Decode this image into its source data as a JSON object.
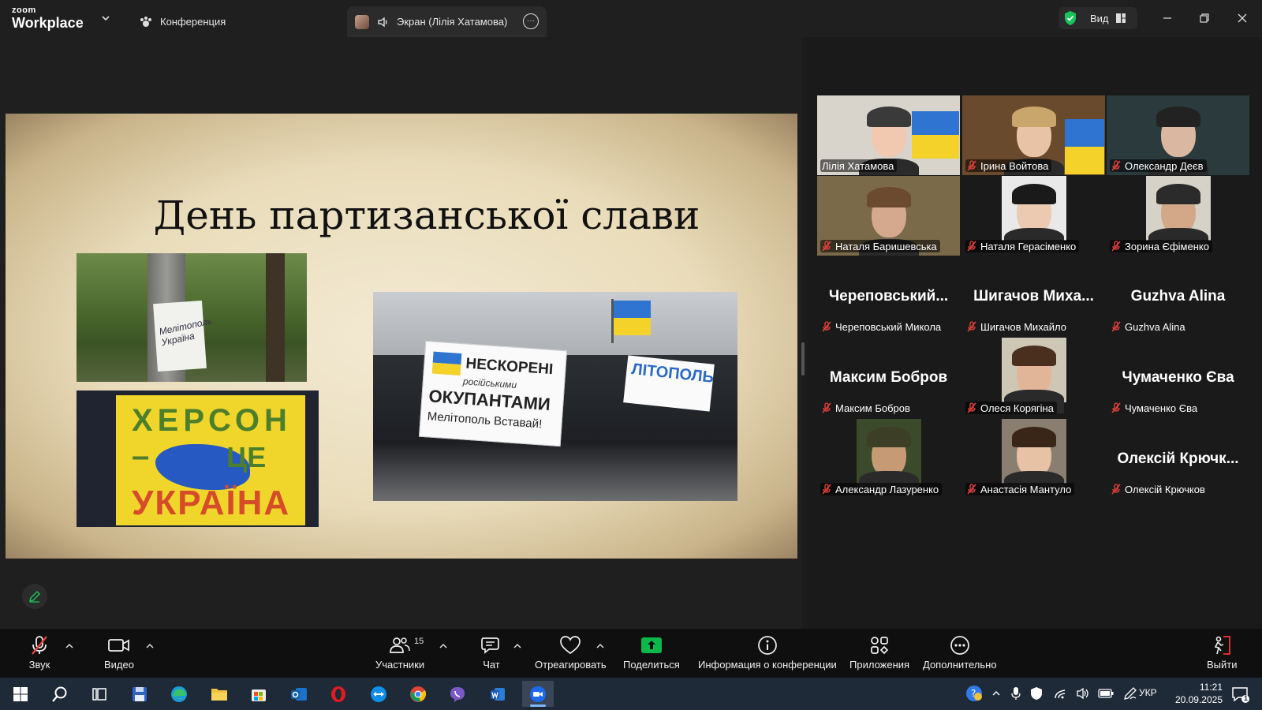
{
  "titlebar": {
    "logo_top": "zoom",
    "logo_bottom": "Workplace",
    "meeting_tab": "Конференция",
    "screen_tab": "Экран (Лілія Хатамова)",
    "view_label": "Вид"
  },
  "slide": {
    "title": "День партизанської слави",
    "photo1_note": "Мелітополь Україна",
    "photo2_line1": "ХЕРСОН –",
    "photo2_line2": "ЦЕ",
    "photo2_line3": "УКРАЇНА",
    "photo3_banner_line1": "НЕСКОРЕНІ",
    "photo3_banner_line2": "російськими",
    "photo3_banner_line3": "ОКУПАНТАМИ",
    "photo3_banner_line4": "Мелітополь Вставай!",
    "photo3_banner2": "ЛІТОПОЛЬ"
  },
  "gallery": {
    "tiles": [
      {
        "name": "Лілія Хатамова",
        "big": "",
        "video": true,
        "active": true,
        "muted": false
      },
      {
        "name": "Ірина Войтова",
        "big": "",
        "video": true,
        "active": false,
        "muted": true
      },
      {
        "name": "Олександр Деєв",
        "big": "",
        "video": true,
        "active": false,
        "muted": true
      },
      {
        "name": "Наталя Баришевська",
        "big": "",
        "video": true,
        "active": false,
        "muted": true
      },
      {
        "name": "Наталя Герасіменко",
        "big": "",
        "video": true,
        "active": false,
        "muted": true
      },
      {
        "name": "Зорина  Єфіменко",
        "big": "",
        "video": true,
        "active": false,
        "muted": true
      },
      {
        "name": "Череповський Микола",
        "big": "Череповський...",
        "video": false,
        "active": false,
        "muted": true
      },
      {
        "name": "Шигачов Михайло",
        "big": "Шигачов  Миха...",
        "video": false,
        "active": false,
        "muted": true
      },
      {
        "name": "Guzhva Alina",
        "big": "Guzhva Alina",
        "video": false,
        "active": false,
        "muted": true
      },
      {
        "name": "Максим Бобров",
        "big": "Максим Бобров",
        "video": false,
        "active": false,
        "muted": true
      },
      {
        "name": "Олеся Корягіна",
        "big": "",
        "video": true,
        "active": false,
        "muted": true
      },
      {
        "name": "Чумаченко Єва",
        "big": "Чумаченко Єва",
        "video": false,
        "active": false,
        "muted": true
      },
      {
        "name": "Александр Лазуренко",
        "big": "",
        "video": true,
        "active": false,
        "muted": true
      },
      {
        "name": "Анастасія Мантуло",
        "big": "",
        "video": true,
        "active": false,
        "muted": true
      },
      {
        "name": "Олексій Крючков",
        "big": "Олексій  Крючк...",
        "video": false,
        "active": false,
        "muted": true
      }
    ]
  },
  "toolbar": {
    "audio": "Звук",
    "video": "Видео",
    "participants": "Участники",
    "participants_count": "15",
    "chat": "Чат",
    "react": "Отреагировать",
    "share": "Поделиться",
    "info": "Информация о конференции",
    "apps": "Приложения",
    "more": "Дополнительно",
    "leave": "Выйти"
  },
  "taskbar": {
    "language": "УКР",
    "time": "11:21",
    "date": "20.09.2025",
    "notification_count": "1"
  },
  "colors": {
    "active_speaker": "#23d959",
    "share_green": "#0cb84a",
    "leave_red": "#e02d2d",
    "muted_red": "#e8413c"
  }
}
